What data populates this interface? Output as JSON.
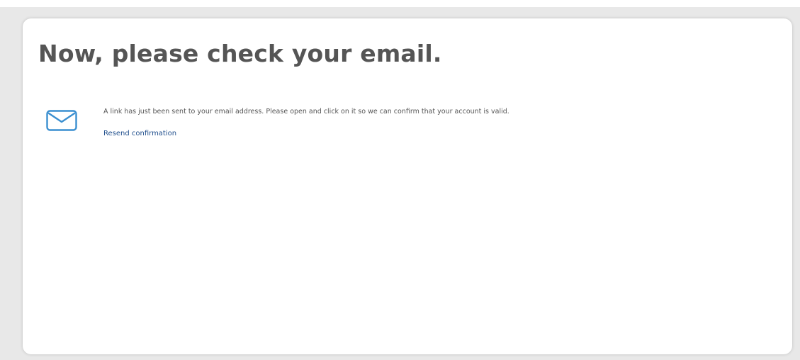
{
  "page": {
    "title": "Now, please check your email.",
    "message": "A link has just been sent to your email address. Please open and click on it so we can confirm that your account is valid.",
    "resend_label": "Resend confirmation",
    "icon": "envelope-icon",
    "colors": {
      "background": "#e8e8e8",
      "card": "#ffffff",
      "title_text": "#555555",
      "body_text": "#555555",
      "link": "#1f4e8c",
      "icon": "#3a8fd0"
    }
  }
}
